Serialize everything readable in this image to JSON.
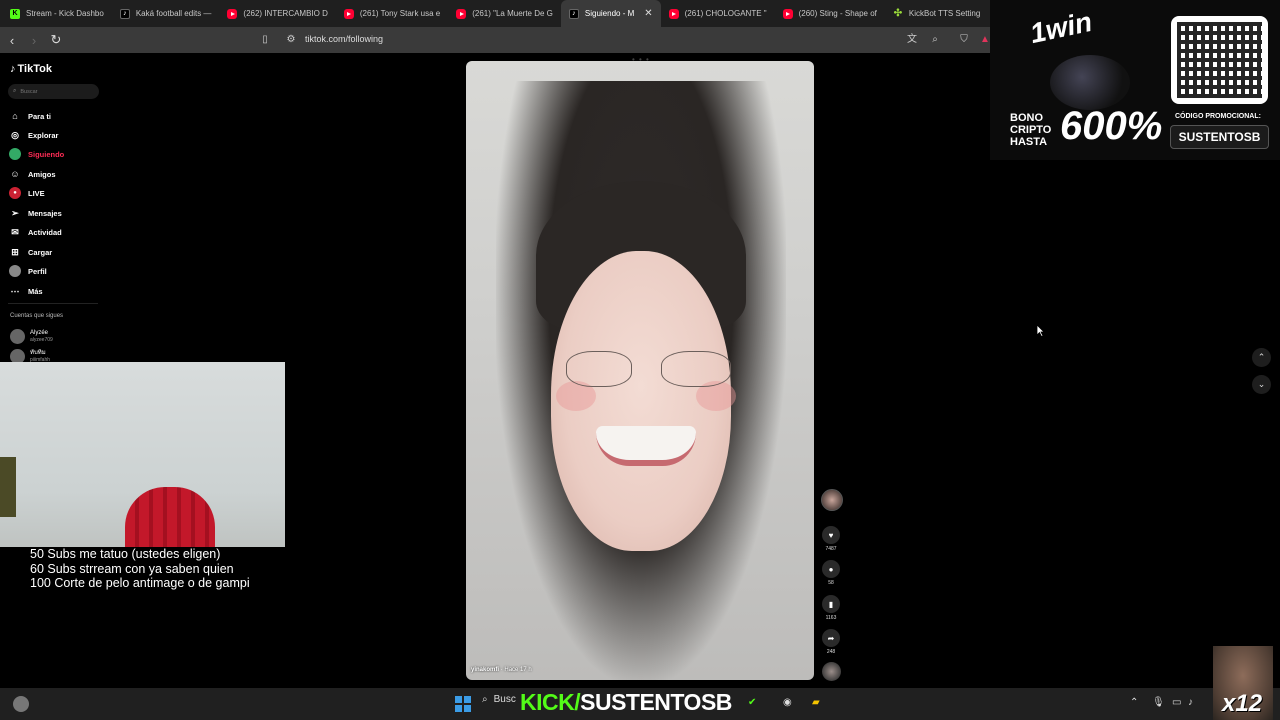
{
  "browser": {
    "tabs": [
      {
        "favicon": "kick-icon",
        "title": "Stream - Kick Dashbo"
      },
      {
        "favicon": "tiktok-icon",
        "title": "Kaká football edits —"
      },
      {
        "favicon": "youtube-icon",
        "title": "(262) INTERCAMBIO D"
      },
      {
        "favicon": "youtube-icon",
        "title": "(261) Tony Stark usa e"
      },
      {
        "favicon": "youtube-icon",
        "title": "(261) \"La Muerte De G"
      },
      {
        "favicon": "tiktok-icon",
        "title": "Siguiendo - M",
        "active": true
      },
      {
        "favicon": "youtube-icon",
        "title": "(261) CHOLOGANTE \""
      },
      {
        "favicon": "youtube-icon",
        "title": "(260) Sting - Shape of"
      },
      {
        "favicon": "kickbot-icon",
        "title": "KickBot TTS Setting"
      }
    ],
    "url": "tiktok.com/following"
  },
  "tiktok": {
    "logo": "TikTok",
    "search_placeholder": "Buscar",
    "nav": [
      {
        "label": "Para ti",
        "icon": "home-icon"
      },
      {
        "label": "Explorar",
        "icon": "compass-icon"
      },
      {
        "label": "Siguiendo",
        "icon": "following-icon",
        "active": true
      },
      {
        "label": "Amigos",
        "icon": "friends-icon"
      },
      {
        "label": "LIVE",
        "icon": "live-icon"
      },
      {
        "label": "Mensajes",
        "icon": "messages-icon"
      },
      {
        "label": "Actividad",
        "icon": "activity-icon"
      },
      {
        "label": "Cargar",
        "icon": "upload-icon"
      },
      {
        "label": "Perfil",
        "icon": "profile-icon"
      },
      {
        "label": "Más",
        "icon": "more-icon"
      }
    ],
    "following_header": "Cuentas que sigues",
    "accounts": [
      {
        "name": "Alyzée",
        "handle": "alyzee709"
      },
      {
        "name": "ทับทิม",
        "handle": "piiimfahh"
      }
    ],
    "video": {
      "author": "yinakomfi",
      "time": "Hace 17 h"
    },
    "actions": {
      "likes": "7487",
      "comments": "58",
      "saves": "1163",
      "shares": "248"
    }
  },
  "ad": {
    "brand": "1win",
    "bonus_line1": "BONO",
    "bonus_line2": "CRIPTO",
    "bonus_line3": "HASTA",
    "percent": "600%",
    "code_label": "CÓDIGO PROMOCIONAL:",
    "code": "SUSTENTOSB"
  },
  "stream_overlay": {
    "goals": [
      "50 Subs me tatuo (ustedes eligen)",
      "60 Subs strream con ya saben quien",
      "100 Corte de pelo antimage o de gampi"
    ],
    "banner_kick": "KICK/",
    "banner_channel": "SUSTENTOSB",
    "multiplier": "x12"
  },
  "taskbar": {
    "search_label": "Busc"
  },
  "colors": {
    "tiktok_accent": "#fe2c55",
    "kick_green": "#53fc18"
  }
}
